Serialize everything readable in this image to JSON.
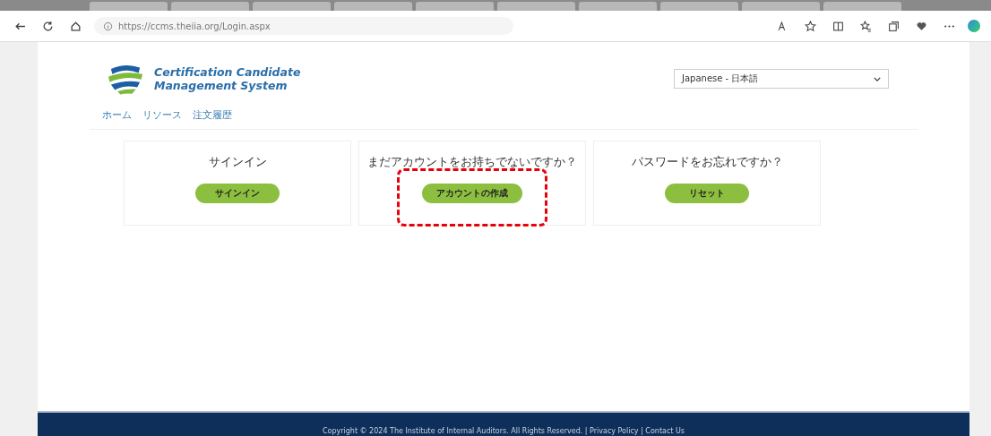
{
  "browser": {
    "url": "https://ccms.theiia.org/Login.aspx"
  },
  "header": {
    "logo_line_1": "Certification Candidate",
    "logo_line_2": "Management System",
    "language": "Japanese - 日本語"
  },
  "nav": [
    {
      "label": "ホーム"
    },
    {
      "label": "リソース"
    },
    {
      "label": "注文履歴"
    }
  ],
  "cards": [
    {
      "title": "サインイン",
      "button": "サインイン",
      "highlighted": false
    },
    {
      "title": "まだアカウントをお持ちでないですか？",
      "button": "アカウントの作成",
      "highlighted": true
    },
    {
      "title": "パスワードをお忘れですか？",
      "button": "リセット",
      "highlighted": false
    }
  ],
  "footer": {
    "text": "Copyright © 2024 The Institute of Internal Auditors. All Rights Reserved. | Privacy Policy | Contact Us"
  }
}
